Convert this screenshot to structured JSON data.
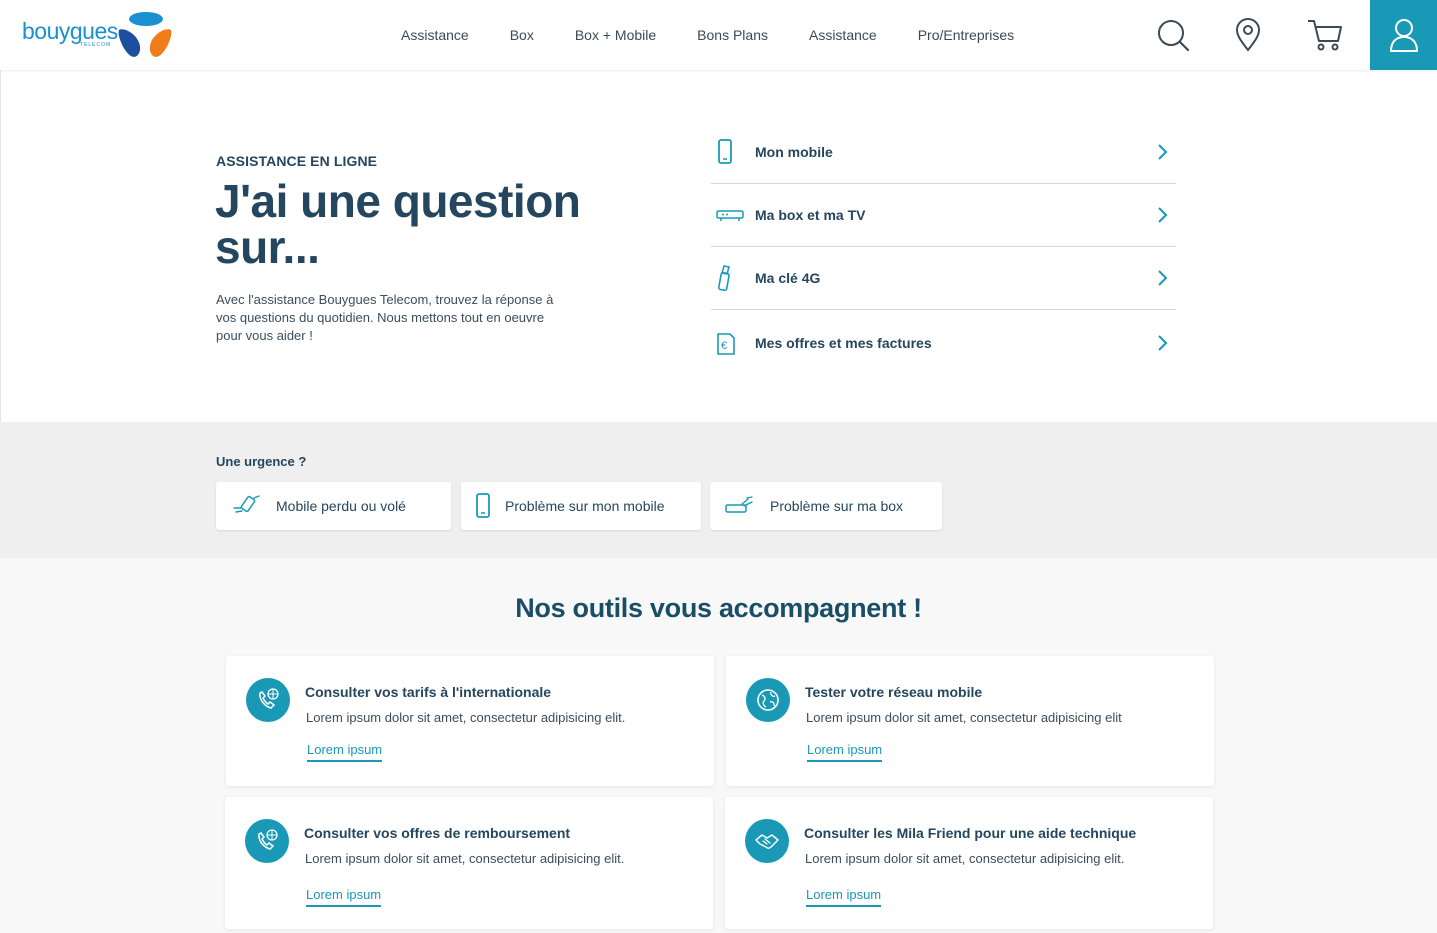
{
  "header": {
    "logo_text": "bouygues",
    "logo_sub": "TELECOM",
    "nav": [
      "Assistance",
      "Box",
      "Box + Mobile",
      "Bons Plans",
      "Assistance",
      "Pro/Entreprises"
    ]
  },
  "hero": {
    "eyebrow": "ASSISTANCE EN LIGNE",
    "title": "J'ai une question sur...",
    "description": "Avec l'assistance Bouygues Telecom, trouvez la réponse à vos questions du quotidien. Nous mettons tout en oeuvre pour vous aider !",
    "topics": [
      {
        "label": "Mon mobile",
        "icon": "smartphone-icon"
      },
      {
        "label": "Ma box et ma TV",
        "icon": "tv-box-icon"
      },
      {
        "label": "Ma clé 4G",
        "icon": "usb-key-icon"
      },
      {
        "label": "Mes offres et mes factures",
        "icon": "euro-invoice-icon"
      }
    ]
  },
  "urgence": {
    "title": "Une urgence ?",
    "buttons": [
      {
        "label": "Mobile perdu ou volé",
        "icon": "lost-phone-icon"
      },
      {
        "label": "Problème sur mon mobile",
        "icon": "smartphone-icon"
      },
      {
        "label": "Problème sur ma box",
        "icon": "box-problem-icon"
      }
    ]
  },
  "tools": {
    "title": "Nos outils vous accompagnent !",
    "cards": [
      {
        "title": "Consulter vos tarifs à l'internationale",
        "desc": "Lorem ipsum dolor sit amet, consectetur adipisicing elit.",
        "link": "Lorem ipsum",
        "icon": "phone-globe-icon"
      },
      {
        "title": "Tester votre réseau mobile",
        "desc": "Lorem ipsum dolor sit amet, consectetur adipisicing elit",
        "link": "Lorem ipsum",
        "icon": "globe-icon"
      },
      {
        "title": "Consulter vos offres de remboursement",
        "desc": "Lorem ipsum dolor sit amet, consectetur adipisicing elit.",
        "link": "Lorem ipsum",
        "icon": "phone-globe-icon"
      },
      {
        "title": "Consulter les Mila Friend pour une aide technique",
        "desc": "Lorem ipsum dolor sit amet, consectetur adipisicing elit.",
        "link": "Lorem ipsum",
        "icon": "handshake-icon"
      }
    ]
  },
  "colors": {
    "primary_dark": "#25465f",
    "accent": "#1999b6",
    "logo_blue": "#1a8fd1",
    "logo_orange": "#f07c1a"
  }
}
